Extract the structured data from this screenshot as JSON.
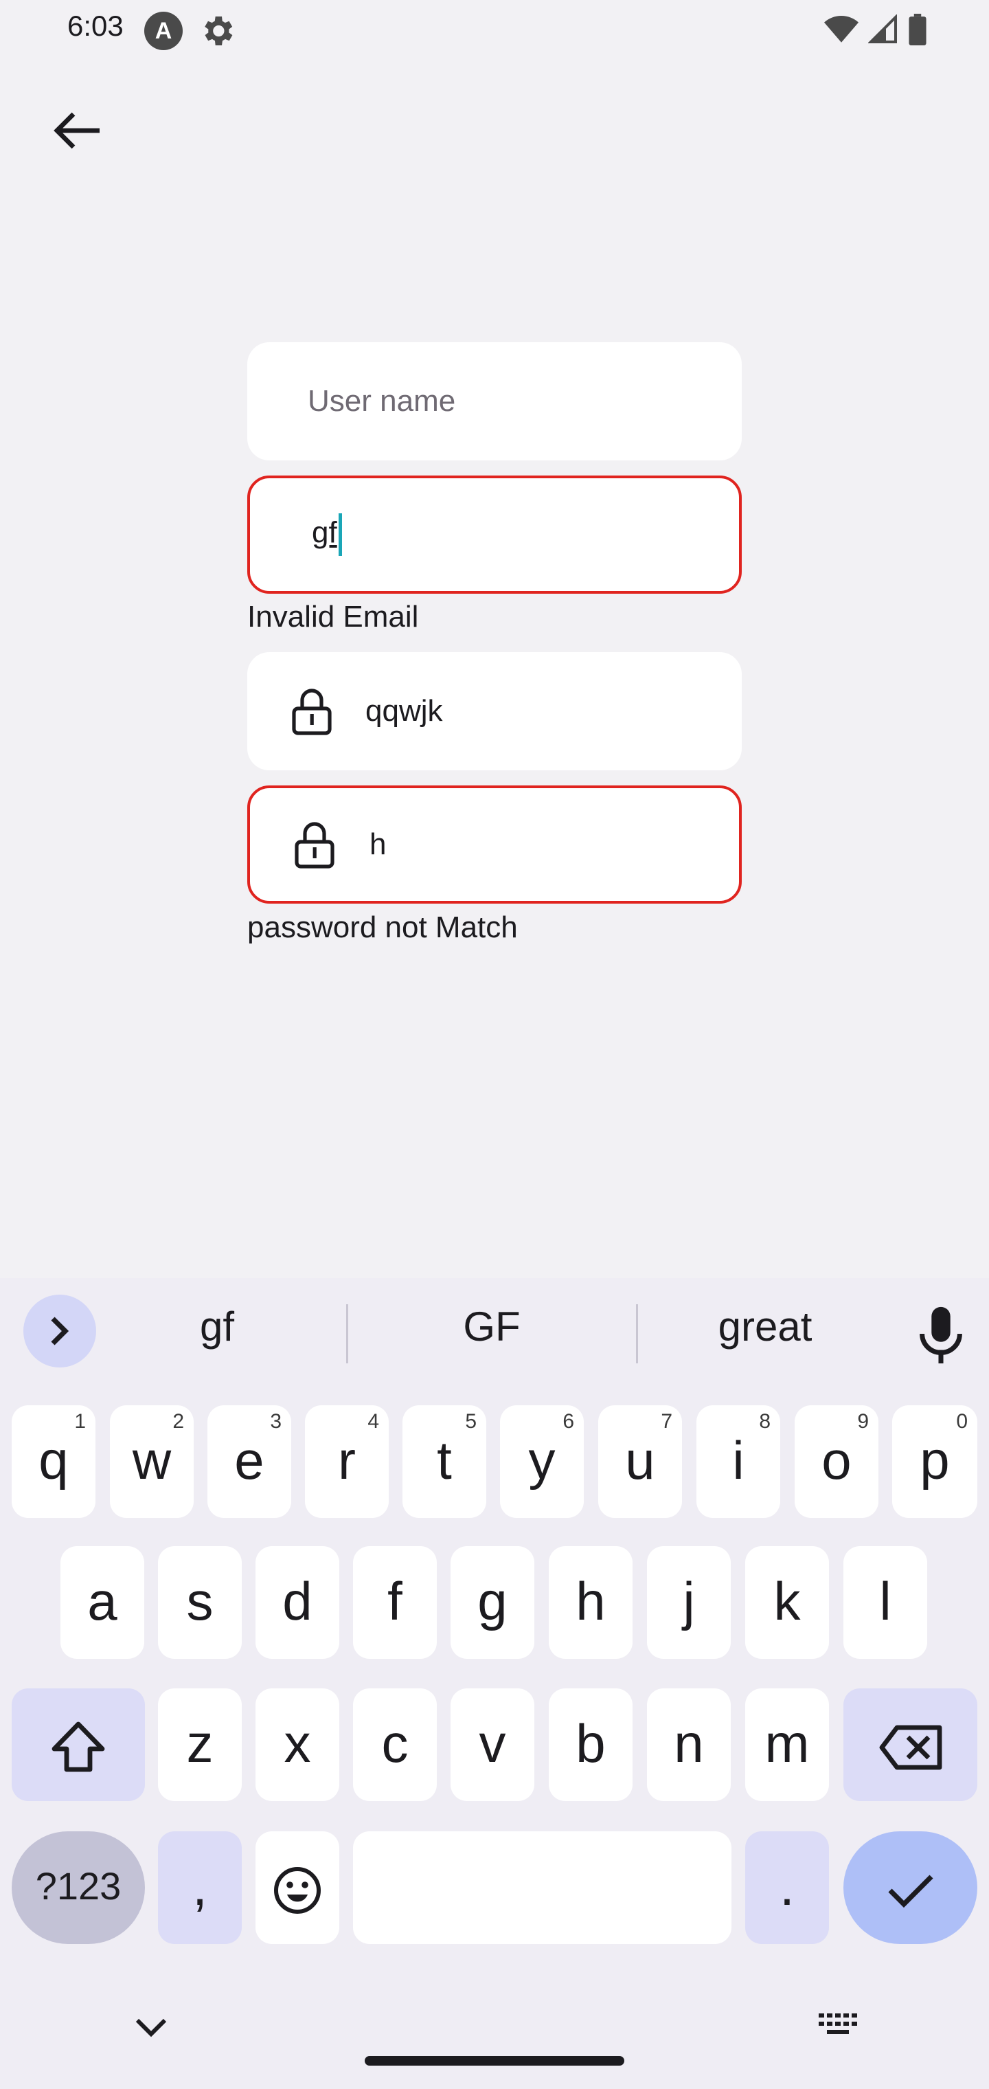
{
  "status_bar": {
    "time": "6:03",
    "app_letter": "A"
  },
  "form": {
    "username": {
      "placeholder": "User name"
    },
    "email": {
      "value": "gf",
      "error": "Invalid Email"
    },
    "password": {
      "value": "qqwjk"
    },
    "confirm_password": {
      "value": "h",
      "error": "password not Match"
    }
  },
  "keyboard": {
    "suggestions": [
      "gf",
      "GF",
      "great"
    ],
    "row1": [
      {
        "key": "q",
        "hint": "1"
      },
      {
        "key": "w",
        "hint": "2"
      },
      {
        "key": "e",
        "hint": "3"
      },
      {
        "key": "r",
        "hint": "4"
      },
      {
        "key": "t",
        "hint": "5"
      },
      {
        "key": "y",
        "hint": "6"
      },
      {
        "key": "u",
        "hint": "7"
      },
      {
        "key": "i",
        "hint": "8"
      },
      {
        "key": "o",
        "hint": "9"
      },
      {
        "key": "p",
        "hint": "0"
      }
    ],
    "row2": [
      "a",
      "s",
      "d",
      "f",
      "g",
      "h",
      "j",
      "k",
      "l"
    ],
    "row3": [
      "z",
      "x",
      "c",
      "v",
      "b",
      "n",
      "m"
    ],
    "symbols_key": "?123",
    "comma_key": ",",
    "period_key": "."
  },
  "colors": {
    "error": "#e0241f",
    "caret": "#1aa6b7",
    "enter_key": "#aebff7",
    "modifier_key": "#dcdcf7"
  }
}
